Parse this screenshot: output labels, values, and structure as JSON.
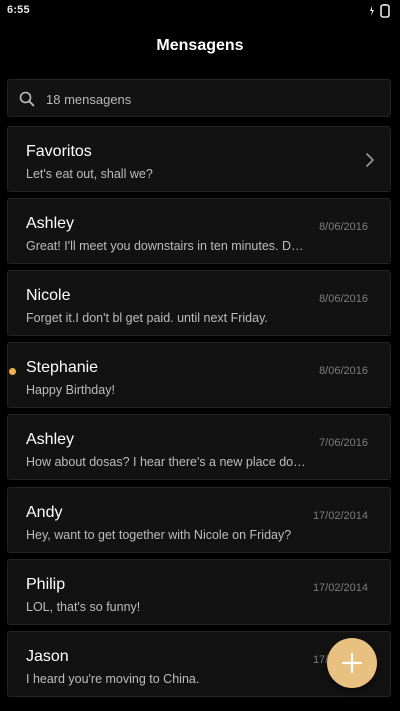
{
  "status_bar": {
    "time": "6:55"
  },
  "header": {
    "title": "Mensagens"
  },
  "search": {
    "text": "18 mensagens",
    "icon": "search-icon"
  },
  "favorites": {
    "name": "Favoritos",
    "preview": "Let's eat out, shall we?",
    "icon": "chevron-right-icon"
  },
  "messages": [
    {
      "name": "Ashley",
      "preview": "Great! I'll meet you downstairs in ten minutes. D…",
      "date": "8/06/2016",
      "unread": false
    },
    {
      "name": "Nicole",
      "preview": "Forget it.I don't bl get paid. until next Friday.",
      "date": "8/06/2016",
      "unread": false
    },
    {
      "name": "Stephanie",
      "preview": "Happy Birthday!",
      "date": "8/06/2016",
      "unread": true
    },
    {
      "name": "Ashley",
      "preview": "How about dosas? I hear there's a new place do…",
      "date": "7/06/2016",
      "unread": false
    },
    {
      "name": "Andy",
      "preview": "Hey, want to get together with Nicole on Friday?",
      "date": "17/02/2014",
      "unread": false
    },
    {
      "name": "Philip",
      "preview": "LOL, that's so funny!",
      "date": "17/02/2014",
      "unread": false
    },
    {
      "name": "Jason",
      "preview": "I heard you're moving to China.",
      "date": "17/02/2014",
      "unread": false
    }
  ],
  "colors": {
    "background": "#000000",
    "card": "#121212",
    "accent": "#e8c07f",
    "unread_dot": "#f2b14a"
  },
  "fab": {
    "icon": "plus-icon"
  }
}
